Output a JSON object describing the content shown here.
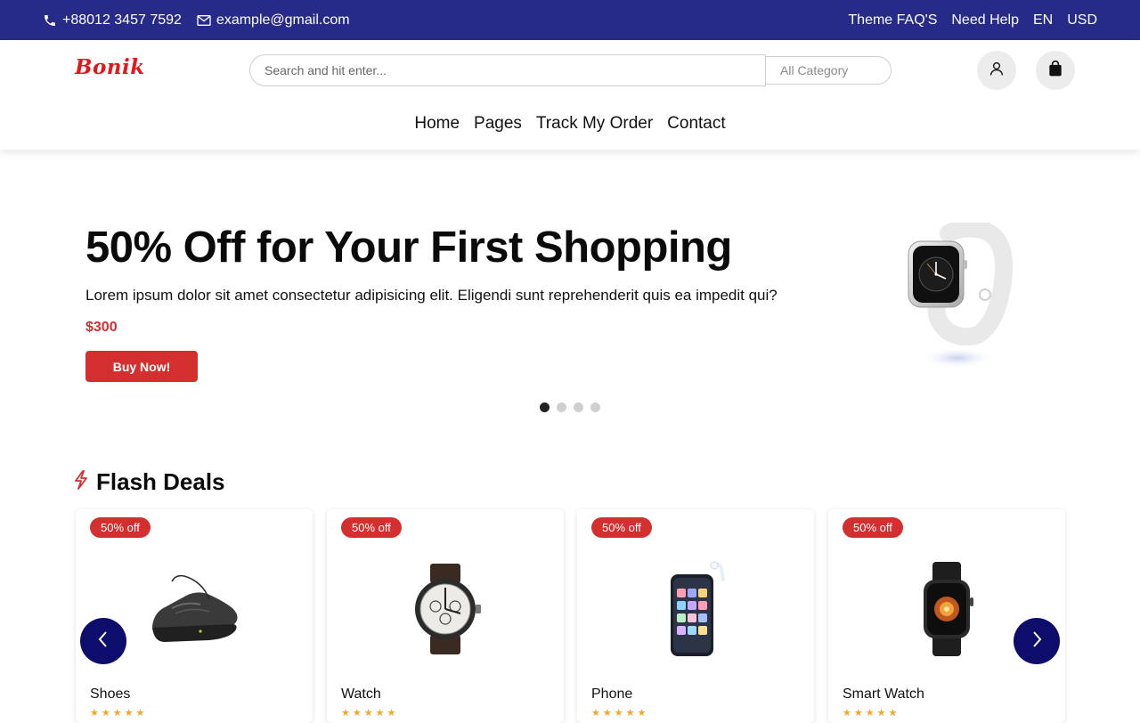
{
  "topbar": {
    "phone": "+88012 3457 7592",
    "email": "example@gmail.com",
    "links": [
      "Theme FAQ'S",
      "Need Help",
      "EN",
      "USD"
    ],
    "bg_color": "#262a88"
  },
  "header": {
    "logo": "Bonik",
    "search_placeholder": "Search and hit enter...",
    "category": "All Category",
    "icons": [
      "user-icon",
      "shopping-bag-icon"
    ]
  },
  "nav": [
    "Home",
    "Pages",
    "Track My Order",
    "Contact"
  ],
  "hero": {
    "title": "50% Off for Your First Shopping",
    "description": "Lorem ipsum dolor sit amet consectetur adipisicing elit. Eligendi sunt reprehenderit quis ea impedit qui?",
    "price": "$300",
    "button": "Buy Now!",
    "image": "smart-watch-image",
    "slides": 4,
    "active_slide": 1
  },
  "flash_deals": {
    "title": "Flash Deals",
    "accent_color": "#d32f2f",
    "products": [
      {
        "name": "Shoes",
        "badge": "50% off",
        "image": "shoe-image"
      },
      {
        "name": "Watch",
        "badge": "50% off",
        "image": "watch-image"
      },
      {
        "name": "Phone",
        "badge": "50% off",
        "image": "phone-image"
      },
      {
        "name": "Smart Watch",
        "badge": "50% off",
        "image": "smart-watch-image"
      }
    ]
  }
}
